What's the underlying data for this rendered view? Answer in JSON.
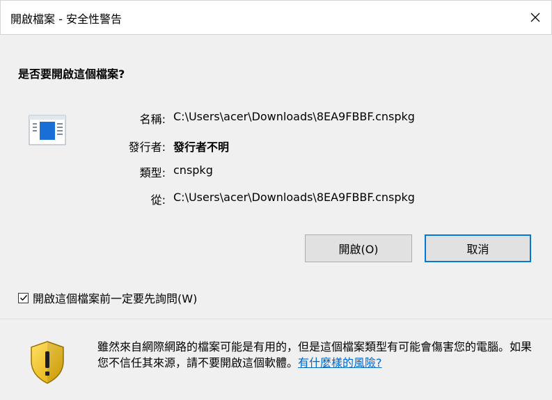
{
  "window": {
    "title": "開啟檔案 - 安全性警告"
  },
  "main": {
    "question": "是否要開啟這個檔案?",
    "details": {
      "name_label": "名稱:",
      "name_value": "C:\\Users\\acer\\Downloads\\8EA9FBBF.cnspkg",
      "publisher_label": "發行者:",
      "publisher_value": "發行者不明",
      "type_label": "類型:",
      "type_value": "cnspkg",
      "from_label": "從:",
      "from_value": "C:\\Users\\acer\\Downloads\\8EA9FBBF.cnspkg"
    },
    "buttons": {
      "open": "開啟(O)",
      "cancel": "取消"
    },
    "checkbox": {
      "label": "開啟這個檔案前一定要先詢問(W)",
      "checked": true
    }
  },
  "warning": {
    "text": "雖然來自網際網路的檔案可能是有用的，但是這個檔案類型有可能會傷害您的電腦。如果您不信任其來源，請不要開啟這個軟體。",
    "link": "有什麼樣的風險?"
  },
  "colors": {
    "accent": "#0078d7",
    "link": "#0066cc",
    "shield_yellow": "#f5c400"
  },
  "icons": [
    "close-icon",
    "file-icon",
    "checkmark-icon",
    "shield-warning-icon"
  ]
}
